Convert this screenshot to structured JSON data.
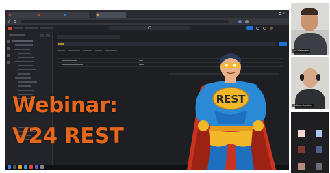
{
  "overlay": {
    "title_line1": "Webinar:",
    "title_line2": "V24 REST"
  },
  "hero": {
    "chest_text": "REST"
  },
  "colors": {
    "title_orange": "#e6661c",
    "hero_blue": "#2b8ad6",
    "hero_gold": "#f2b82a",
    "cape_red": "#c9331f",
    "accent_blue": "#1f73d6"
  },
  "participants": [
    {
      "name": "Ivo Weinmann"
    },
    {
      "name": "Kotlaus Brandner"
    }
  ],
  "icons": {
    "close": "close-icon",
    "menu": "menu-icon",
    "search": "search-icon",
    "microphone": "microphone-icon"
  }
}
